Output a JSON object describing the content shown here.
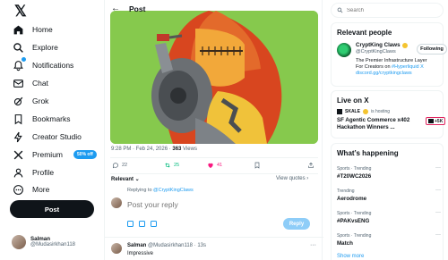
{
  "nav": {
    "logo": "𝕏",
    "items": [
      {
        "label": "Home"
      },
      {
        "label": "Explore"
      },
      {
        "label": "Notifications"
      },
      {
        "label": "Chat"
      },
      {
        "label": "Grok"
      },
      {
        "label": "Bookmarks"
      },
      {
        "label": "Creator Studio"
      },
      {
        "label": "Premium",
        "badge": "50% off"
      },
      {
        "label": "Profile"
      },
      {
        "label": "More"
      }
    ],
    "post_label": "Post"
  },
  "account": {
    "name": "Salman",
    "handle": "@Mudasirkhan118"
  },
  "main": {
    "title": "Post",
    "timestamp": "9:28 PM · Feb 24, 2026 · ",
    "views_count": "363",
    "views_label": " Views",
    "actions": {
      "replies": "22",
      "reposts": "25",
      "likes": "41"
    },
    "relevant": "Relevant ⌄",
    "view_quotes": "View quotes ›",
    "replying_prefix": "Replying to ",
    "replying_handle": "@CryptKingClaws",
    "reply_placeholder": "Post your reply",
    "reply_button": "Reply",
    "reply_card": {
      "name": "Salman",
      "meta": " @Mudasirkhan118 · 13s",
      "text": "Impressive",
      "more": "···"
    }
  },
  "right": {
    "search_placeholder": "Search",
    "relevant_people_title": "Relevant people",
    "person": {
      "name": "CryptKing Claws",
      "handle": "@CryptKingClaws",
      "follow_label": "Following",
      "bio": "The Premier Infrastructure Layer For Creators on ",
      "bio_link1": "#Hyperliquid",
      "bio_link2": "X discord.gg/cryptkingclaws"
    },
    "live_title": "Live on X",
    "live": {
      "host": "SKALE",
      "host_suffix": " is hosting",
      "title": "SF Agentic Commerce x402 Hackathon Winners ...",
      "count": "+5K"
    },
    "happening_title": "What’s happening",
    "trends": [
      {
        "category": "Sports · Trending",
        "name": "#T20WC2026"
      },
      {
        "category": "Trending",
        "name": "Aerodrome"
      },
      {
        "category": "Sports · Trending",
        "name": "#PAKvsENG"
      },
      {
        "category": "Sports · Trending",
        "name": "Match"
      }
    ],
    "show_more": "Show more"
  },
  "colors": {
    "accent": "#1d9bf0",
    "text": "#0f1419",
    "muted": "#536471",
    "like": "#f91880",
    "media_bg": "#86c94d"
  }
}
